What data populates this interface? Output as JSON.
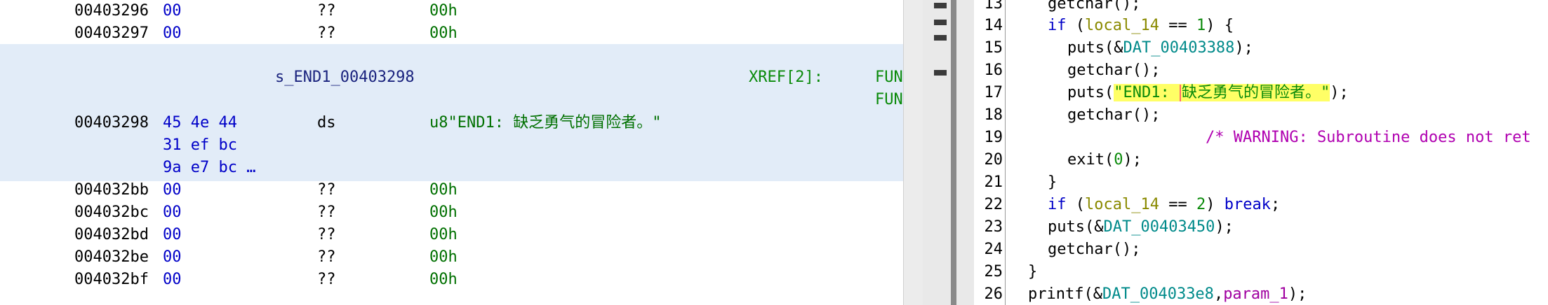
{
  "listing": {
    "rows_top": [
      {
        "addr": "00403296",
        "byte": "00",
        "mnem": "??",
        "opnd": "00h"
      },
      {
        "addr": "00403297",
        "byte": "00",
        "mnem": "??",
        "opnd": "00h"
      }
    ],
    "label": "s_END1_00403298",
    "xref": "XREF[2]:",
    "fun1": "FUN",
    "fun2": "FUN",
    "data_row": {
      "addr": "00403298",
      "bytes": [
        "45 4e 44",
        "31 ef bc",
        "9a e7 bc …"
      ],
      "mnem": "ds",
      "opnd": "u8\"END1: 缺乏勇气的冒险者。\""
    },
    "rows_bottom": [
      {
        "addr": "004032bb",
        "byte": "00",
        "mnem": "??",
        "opnd": "00h"
      },
      {
        "addr": "004032bc",
        "byte": "00",
        "mnem": "??",
        "opnd": "00h"
      },
      {
        "addr": "004032bd",
        "byte": "00",
        "mnem": "??",
        "opnd": "00h"
      },
      {
        "addr": "004032be",
        "byte": "00",
        "mnem": "??",
        "opnd": "00h"
      },
      {
        "addr": "004032bf",
        "byte": "00",
        "mnem": "??",
        "opnd": "00h"
      }
    ]
  },
  "decompiler": {
    "line_numbers": [
      "13",
      "14",
      "15",
      "16",
      "17",
      "18",
      "19",
      "20",
      "21",
      "22",
      "23",
      "24",
      "25",
      "26"
    ],
    "l13": {
      "fn": "getchar",
      "tail": "();"
    },
    "l14": {
      "kw": "if",
      "open": " (",
      "var": "local_14",
      "op": " == ",
      "num": "1",
      "close": ") {"
    },
    "l15": {
      "fn": "puts",
      "open": "(&",
      "dat": "DAT_00403388",
      "close": ");"
    },
    "l16": {
      "fn": "getchar",
      "tail": "();"
    },
    "l17": {
      "fn": "puts",
      "open": "(",
      "str_a": "\"END1: ",
      "str_b": "缺乏勇气的冒险者。\"",
      "close": ");"
    },
    "l18": {
      "fn": "getchar",
      "tail": "();"
    },
    "l19": {
      "comment": "/* WARNING: Subroutine does not ret"
    },
    "l20": {
      "fn": "exit",
      "open": "(",
      "num": "0",
      "close": ");"
    },
    "l21": {
      "text": "}"
    },
    "l22": {
      "kw": "if",
      "open": " (",
      "var": "local_14",
      "op": " == ",
      "num": "2",
      "close": ") ",
      "kw2": "break",
      "end": ";"
    },
    "l23": {
      "fn": "puts",
      "open": "(&",
      "dat": "DAT_00403450",
      "close": ");"
    },
    "l24": {
      "fn": "getchar",
      "tail": "();"
    },
    "l25": {
      "text": "}"
    },
    "l26": {
      "fn": "printf",
      "open": "(&",
      "dat": "DAT_004033e8",
      "sep": ",",
      "prm": "param_1",
      "close": ");"
    }
  }
}
